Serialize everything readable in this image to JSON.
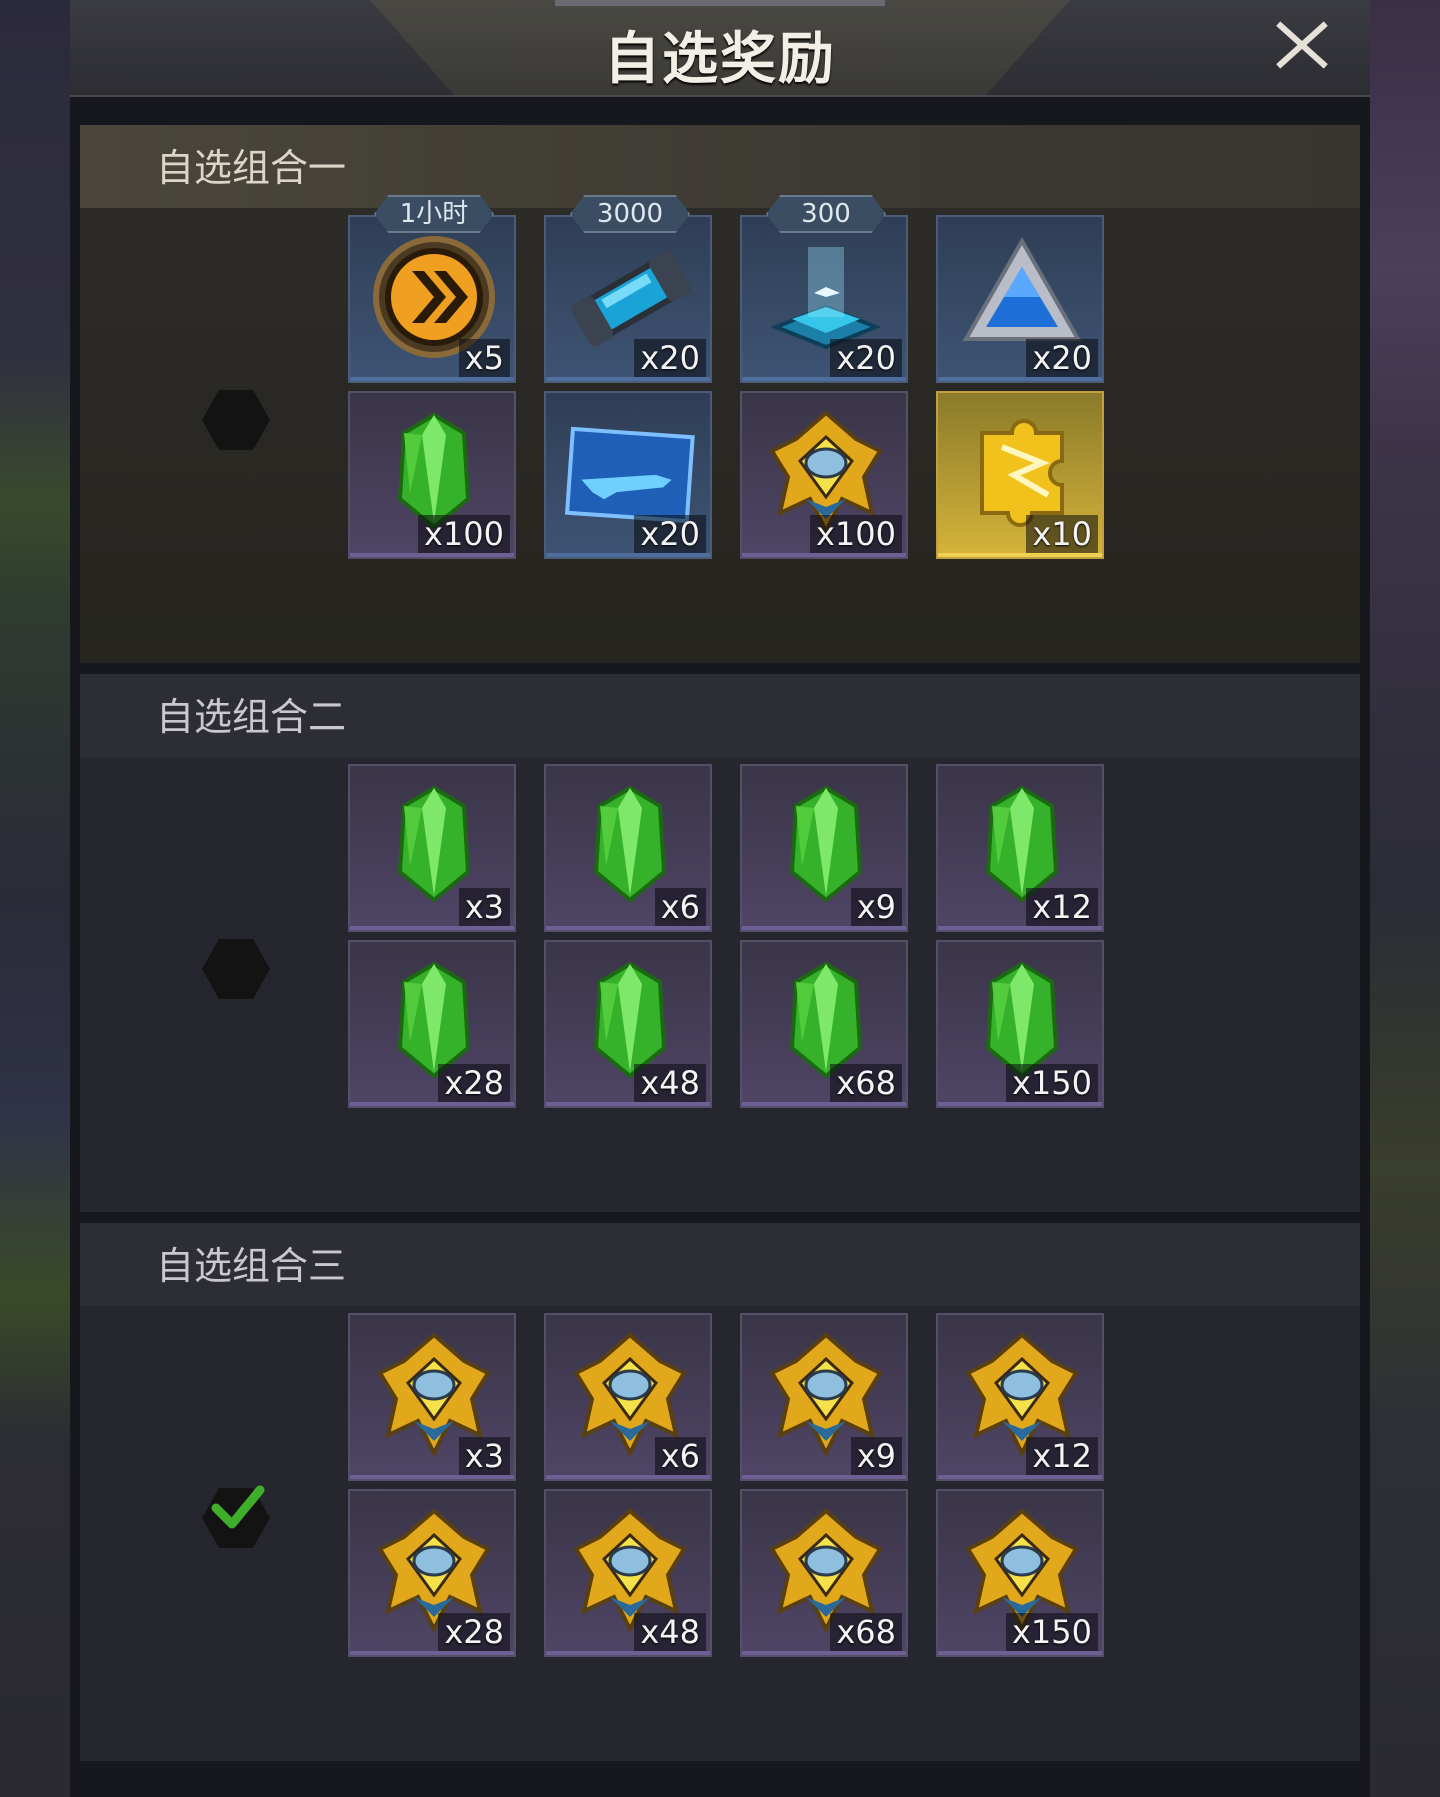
{
  "window": {
    "title": "自选奖励"
  },
  "groups": [
    {
      "name": "自选组合一",
      "selected": false,
      "items": [
        {
          "icon": "speed-boost-icon",
          "tag": "1小时",
          "qty": "x5",
          "style": "blue"
        },
        {
          "icon": "energy-canister-icon",
          "tag": "3000",
          "qty": "x20",
          "style": "blue"
        },
        {
          "icon": "hologram-pad-icon",
          "tag": "300",
          "qty": "x20",
          "style": "blue"
        },
        {
          "icon": "blue-triangle-crystal-icon",
          "tag": "",
          "qty": "x20",
          "style": "blue"
        },
        {
          "icon": "green-crystal-icon",
          "tag": "",
          "qty": "x100",
          "style": "purple"
        },
        {
          "icon": "blueprint-card-icon",
          "tag": "",
          "qty": "x20",
          "style": "blue"
        },
        {
          "icon": "gold-badge-icon",
          "tag": "",
          "qty": "x100",
          "style": "purple"
        },
        {
          "icon": "gold-puzzle-piece-icon",
          "tag": "",
          "qty": "x10",
          "style": "gold"
        }
      ]
    },
    {
      "name": "自选组合二",
      "selected": false,
      "items": [
        {
          "icon": "green-crystal-icon",
          "tag": "",
          "qty": "x3",
          "style": "purple"
        },
        {
          "icon": "green-crystal-icon",
          "tag": "",
          "qty": "x6",
          "style": "purple"
        },
        {
          "icon": "green-crystal-icon",
          "tag": "",
          "qty": "x9",
          "style": "purple"
        },
        {
          "icon": "green-crystal-icon",
          "tag": "",
          "qty": "x12",
          "style": "purple"
        },
        {
          "icon": "green-crystal-icon",
          "tag": "",
          "qty": "x28",
          "style": "purple"
        },
        {
          "icon": "green-crystal-icon",
          "tag": "",
          "qty": "x48",
          "style": "purple"
        },
        {
          "icon": "green-crystal-icon",
          "tag": "",
          "qty": "x68",
          "style": "purple"
        },
        {
          "icon": "green-crystal-icon",
          "tag": "",
          "qty": "x150",
          "style": "purple"
        }
      ]
    },
    {
      "name": "自选组合三",
      "selected": true,
      "items": [
        {
          "icon": "gold-badge-icon",
          "tag": "",
          "qty": "x3",
          "style": "purple"
        },
        {
          "icon": "gold-badge-icon",
          "tag": "",
          "qty": "x6",
          "style": "purple"
        },
        {
          "icon": "gold-badge-icon",
          "tag": "",
          "qty": "x9",
          "style": "purple"
        },
        {
          "icon": "gold-badge-icon",
          "tag": "",
          "qty": "x12",
          "style": "purple"
        },
        {
          "icon": "gold-badge-icon",
          "tag": "",
          "qty": "x28",
          "style": "purple"
        },
        {
          "icon": "gold-badge-icon",
          "tag": "",
          "qty": "x48",
          "style": "purple"
        },
        {
          "icon": "gold-badge-icon",
          "tag": "",
          "qty": "x68",
          "style": "purple"
        },
        {
          "icon": "gold-badge-icon",
          "tag": "",
          "qty": "x150",
          "style": "purple"
        }
      ]
    }
  ],
  "colors": {
    "accent_check": "#3fae2a",
    "title_text": "#f3efe6",
    "panel_bg": "#17181d"
  }
}
